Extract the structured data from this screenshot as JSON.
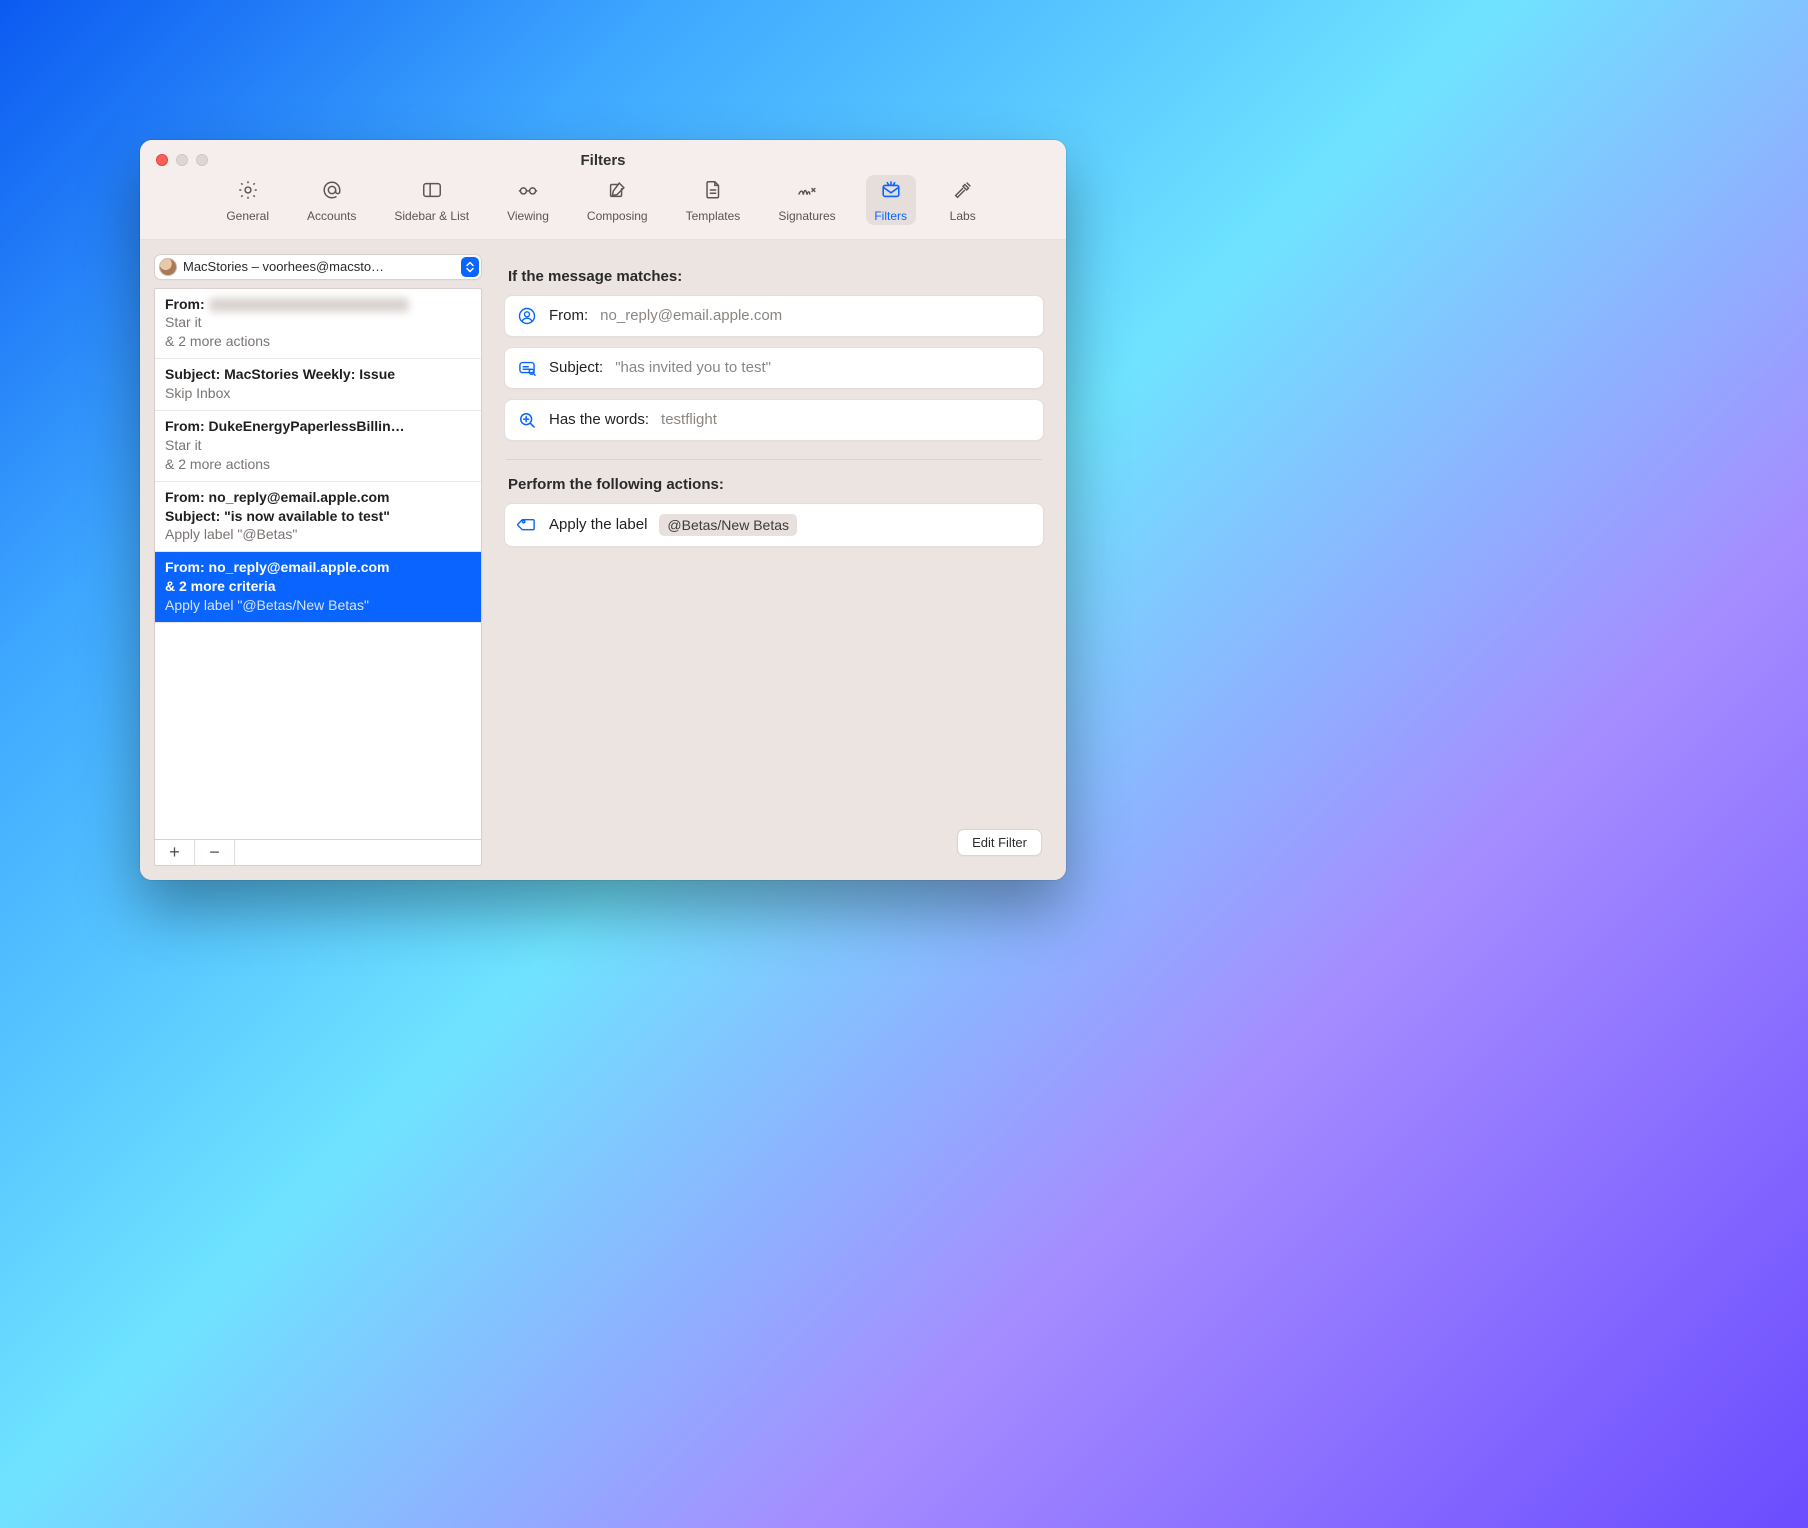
{
  "window": {
    "title": "Filters"
  },
  "toolbar": {
    "active": "Filters",
    "items": [
      {
        "id": "general",
        "label": "General"
      },
      {
        "id": "accounts",
        "label": "Accounts"
      },
      {
        "id": "sidebar",
        "label": "Sidebar & List"
      },
      {
        "id": "viewing",
        "label": "Viewing"
      },
      {
        "id": "composing",
        "label": "Composing"
      },
      {
        "id": "templates",
        "label": "Templates"
      },
      {
        "id": "signatures",
        "label": "Signatures"
      },
      {
        "id": "filters",
        "label": "Filters"
      },
      {
        "id": "labs",
        "label": "Labs"
      }
    ]
  },
  "account_picker": {
    "label": "MacStories – voorhees@macsto…"
  },
  "filter_list": [
    {
      "line1": "From:",
      "blurred": true,
      "sub1": "Star it",
      "sub2": "& 2 more actions"
    },
    {
      "line1": "Subject: MacStories Weekly: Issue",
      "sub1": "Skip Inbox"
    },
    {
      "line1": "From: DukeEnergyPaperlessBillin…",
      "sub1": "Star it",
      "sub2": "& 2 more actions"
    },
    {
      "line1": "From: no_reply@email.apple.com",
      "line2": "Subject: \"is now available to test\"",
      "sub1": "Apply label \"@Betas\""
    },
    {
      "selected": true,
      "line1": "From: no_reply@email.apple.com",
      "line2": "& 2 more criteria",
      "sub1": "Apply label \"@Betas/New Betas\""
    }
  ],
  "footer": {
    "add": "+",
    "remove": "−"
  },
  "detail": {
    "match_title": "If the message matches:",
    "conditions": [
      {
        "icon": "person",
        "key": "From:",
        "value": "no_reply@email.apple.com"
      },
      {
        "icon": "subject",
        "key": "Subject:",
        "value": "\"has invited you to test\""
      },
      {
        "icon": "search",
        "key": "Has the words:",
        "value": "testflight"
      }
    ],
    "actions_title": "Perform the following actions:",
    "action": {
      "key": "Apply the label",
      "chip": "@Betas/New Betas"
    },
    "edit_button": "Edit Filter"
  }
}
